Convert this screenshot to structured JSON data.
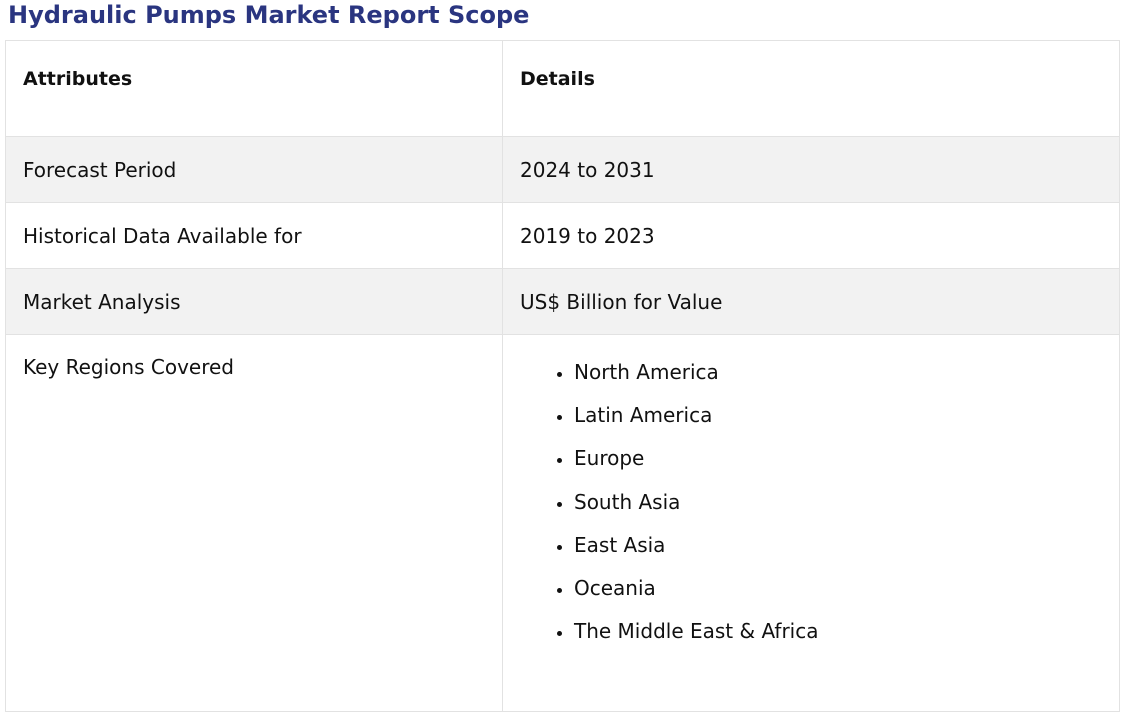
{
  "title": "Hydraulic Pumps Market Report Scope",
  "table": {
    "headers": {
      "attribute": "Attributes",
      "details": "Details"
    },
    "rows": [
      {
        "attribute": "Forecast Period",
        "details": "2024 to 2031"
      },
      {
        "attribute": "Historical Data Available for",
        "details": "2019 to 2023"
      },
      {
        "attribute": "Market Analysis",
        "details": "US$ Billion for Value"
      }
    ],
    "regions": {
      "attribute": "Key Regions Covered",
      "items": [
        "North America",
        "Latin America",
        "Europe",
        "South Asia",
        "East Asia",
        "Oceania",
        "The Middle East & Africa"
      ]
    }
  },
  "colors": {
    "title": "#2a3580",
    "shaded_row": "#f2f2f2",
    "border": "#e2e2e2"
  }
}
